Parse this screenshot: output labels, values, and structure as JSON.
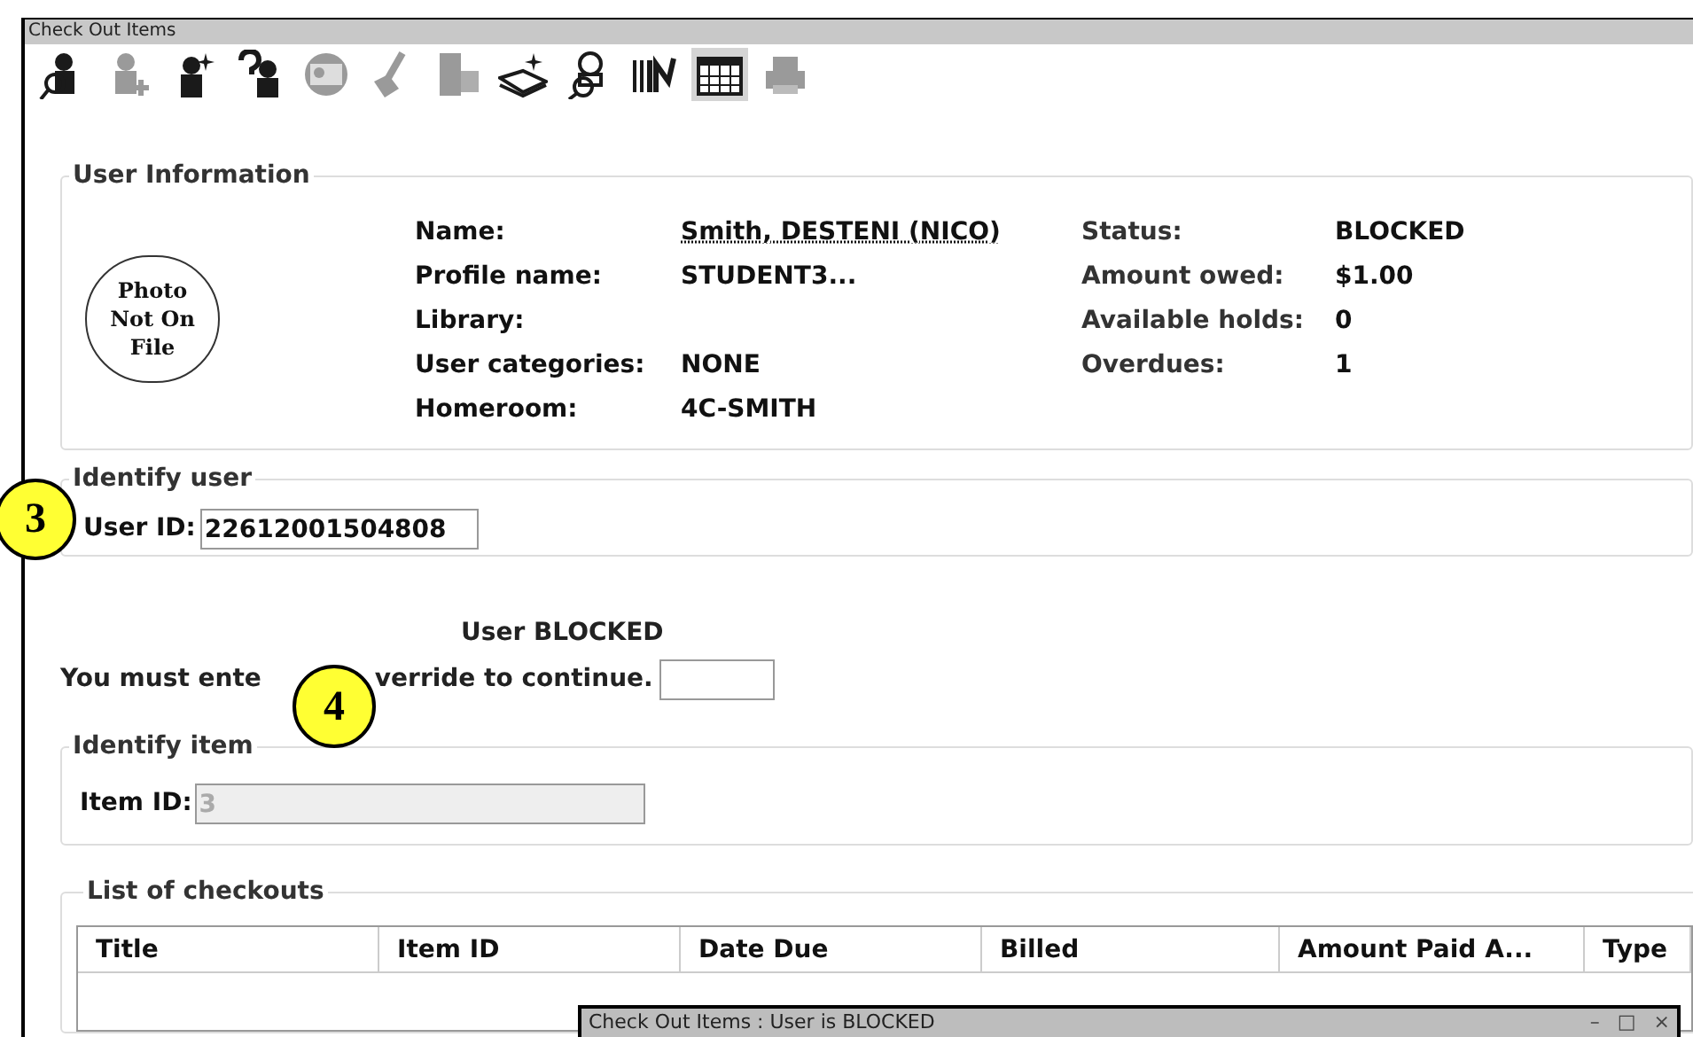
{
  "window": {
    "title": "Check Out Items"
  },
  "toolbar": [
    {
      "kind": "find-user",
      "disabled": false,
      "selected": false
    },
    {
      "kind": "add-user",
      "disabled": true,
      "selected": false
    },
    {
      "kind": "new-user",
      "disabled": false,
      "selected": false
    },
    {
      "kind": "user-help",
      "disabled": false,
      "selected": false
    },
    {
      "kind": "card",
      "disabled": true,
      "selected": false
    },
    {
      "kind": "brush",
      "disabled": true,
      "selected": false
    },
    {
      "kind": "hand",
      "disabled": true,
      "selected": false
    },
    {
      "kind": "book",
      "disabled": false,
      "selected": false
    },
    {
      "kind": "search-user",
      "disabled": false,
      "selected": false
    },
    {
      "kind": "barcode",
      "disabled": false,
      "selected": false
    },
    {
      "kind": "calendar",
      "disabled": false,
      "selected": true
    },
    {
      "kind": "printer",
      "disabled": true,
      "selected": false
    }
  ],
  "user_information": {
    "legend": "User Information",
    "photo": "Photo Not On File",
    "left": [
      {
        "label": "Name:",
        "value": "Smith, DESTENI (NICO)",
        "kind": "link"
      },
      {
        "label": "Profile name:",
        "value": "STUDENT3...",
        "kind": "text"
      },
      {
        "label": "Library:"
      },
      {
        "label": "User categories:",
        "value": "NONE",
        "kind": "text"
      },
      {
        "label": "Homeroom:",
        "value": "4C-SMITH",
        "kind": "text"
      }
    ],
    "right": [
      {
        "label": "Status:",
        "value": "BLOCKED"
      },
      {
        "label": "Amount owed:",
        "value": "$1.00"
      },
      {
        "label": "Available holds:",
        "value": "0"
      },
      {
        "label": "Overdues:",
        "value": "1"
      }
    ]
  },
  "identify_user": {
    "legend": "Identify user",
    "label": "User ID:",
    "value": "22612001504808"
  },
  "blocked": {
    "heading": "User BLOCKED",
    "prompt": [
      "You must ente",
      "verride to continue."
    ]
  },
  "identify_item": {
    "legend": "Identify item",
    "label": "Item ID:",
    "value": "3",
    "disabled": true
  },
  "checkouts": {
    "legend": "List of checkouts",
    "columns": [
      "Title",
      "Item ID",
      "Date Due",
      "Billed",
      "Amount Paid A...",
      "Type"
    ]
  },
  "dialog": {
    "title": "Check Out Items : User is BLOCKED",
    "controls": [
      "–",
      "□",
      "×"
    ]
  },
  "callouts": [
    "3",
    "4"
  ]
}
